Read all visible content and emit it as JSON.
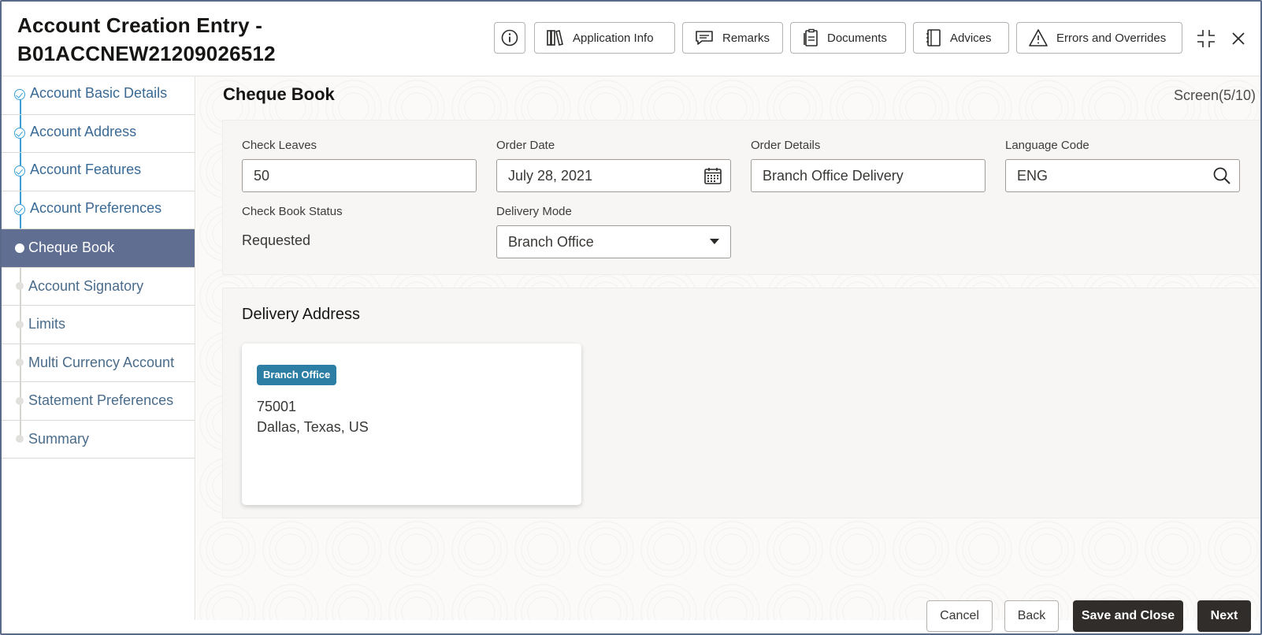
{
  "header": {
    "title_line1": "Account Creation Entry -",
    "title_line2": "B01ACCNEW21209026512",
    "buttons": {
      "application_info": "Application Info",
      "remarks": "Remarks",
      "documents": "Documents",
      "advices": "Advices",
      "errors_overrides": "Errors and Overrides"
    }
  },
  "sidebar": {
    "items": [
      {
        "label": "Account Basic Details",
        "status": "done"
      },
      {
        "label": "Account Address",
        "status": "done"
      },
      {
        "label": "Account Features",
        "status": "done"
      },
      {
        "label": "Account Preferences",
        "status": "done"
      },
      {
        "label": "Cheque Book",
        "status": "active"
      },
      {
        "label": "Account Signatory",
        "status": "todo"
      },
      {
        "label": "Limits",
        "status": "todo"
      },
      {
        "label": "Multi Currency Account",
        "status": "todo"
      },
      {
        "label": "Statement Preferences",
        "status": "todo"
      },
      {
        "label": "Summary",
        "status": "todo"
      }
    ]
  },
  "main": {
    "section_title": "Cheque Book",
    "screen_counter": "Screen(5/10)",
    "fields": {
      "check_leaves": {
        "label": "Check Leaves",
        "value": "50"
      },
      "order_date": {
        "label": "Order Date",
        "value": "July 28, 2021"
      },
      "order_details": {
        "label": "Order Details",
        "value": "Branch Office Delivery"
      },
      "language_code": {
        "label": "Language Code",
        "value": "ENG"
      },
      "check_book_status": {
        "label": "Check Book Status",
        "value": "Requested"
      },
      "delivery_mode": {
        "label": "Delivery Mode",
        "value": "Branch Office"
      }
    },
    "delivery_address": {
      "title": "Delivery Address",
      "badge": "Branch Office",
      "line1": "75001",
      "line2": "Dallas, Texas, US"
    }
  },
  "footer": {
    "cancel": "Cancel",
    "back": "Back",
    "save_close": "Save and Close",
    "next": "Next"
  },
  "colors": {
    "active_nav": "#5f6e91",
    "badge": "#2d7ea4",
    "primary_button": "#312d2a",
    "step_done": "#3b9fd6",
    "frame_border": "#5a6a89"
  }
}
